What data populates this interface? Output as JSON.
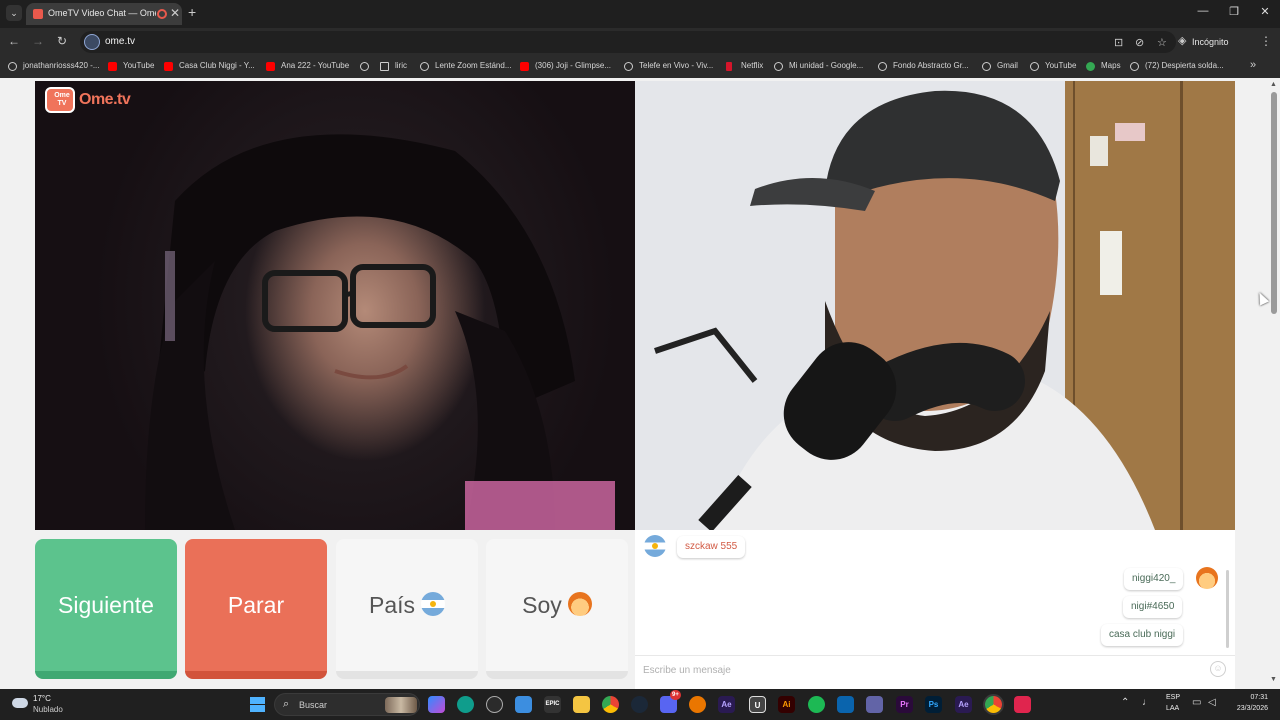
{
  "browser": {
    "tab_title": "OmeTV Video Chat — Ome",
    "tab_close": "✕",
    "new_tab": "+",
    "url": "ome.tv",
    "incognito_label": "Incógnito",
    "window": {
      "minimize": "—",
      "restore": "❐",
      "close": "✕"
    }
  },
  "bookmarks": [
    {
      "label": "jonathanriosss420 -...",
      "icon": "globe-icon"
    },
    {
      "label": "YouTube",
      "icon": "youtube-icon"
    },
    {
      "label": "Casa Club Niggi - Y...",
      "icon": "youtube-icon"
    },
    {
      "label": "Ana 222 - YouTube",
      "icon": "youtube-icon"
    },
    {
      "label": "",
      "icon": "globe-icon"
    },
    {
      "label": "liric",
      "icon": "folder-icon"
    },
    {
      "label": "Lente Zoom Estánd...",
      "icon": "globe-icon"
    },
    {
      "label": "(306) Joji - Glimpse...",
      "icon": "youtube-icon"
    },
    {
      "label": "Telefe en Vivo - Viv...",
      "icon": "globe-icon"
    },
    {
      "label": "Netflix",
      "icon": "netflix-icon"
    },
    {
      "label": "Mi unidad - Google...",
      "icon": "globe-icon"
    },
    {
      "label": "Fondo Abstracto Gr...",
      "icon": "globe-icon"
    },
    {
      "label": "Gmail",
      "icon": "globe-icon"
    },
    {
      "label": "YouTube",
      "icon": "globe-icon"
    },
    {
      "label": "Maps",
      "icon": "maps-icon"
    },
    {
      "label": "(72) Despierta solda...",
      "icon": "globe-icon"
    }
  ],
  "page": {
    "logo_tv_text": "Ome\nTV",
    "logo_text": "Ome.tv",
    "buttons": {
      "next": "Siguiente",
      "stop": "Parar",
      "country": "País",
      "gender": "Soy"
    },
    "chat": {
      "incoming": [
        {
          "text": "szckaw 555",
          "avatar": "argentina-flag-icon"
        }
      ],
      "outgoing": [
        {
          "text": "niggi420_",
          "avatar": "boy-emoji-icon"
        },
        {
          "text": "nigi#4650"
        },
        {
          "text": "casa club niggi"
        }
      ],
      "placeholder": "Escribe un mensaje"
    },
    "colors": {
      "next": "#5cc38d",
      "stop": "#ea7058",
      "brand": "#f0745b"
    }
  },
  "taskbar": {
    "weather_temp": "17°C",
    "weather_desc": "Nublado",
    "search_placeholder": "Buscar",
    "lang_top": "ESP",
    "lang_bottom": "LAA",
    "time": "07:31",
    "date": "23/3/2026",
    "badge": "9+"
  }
}
